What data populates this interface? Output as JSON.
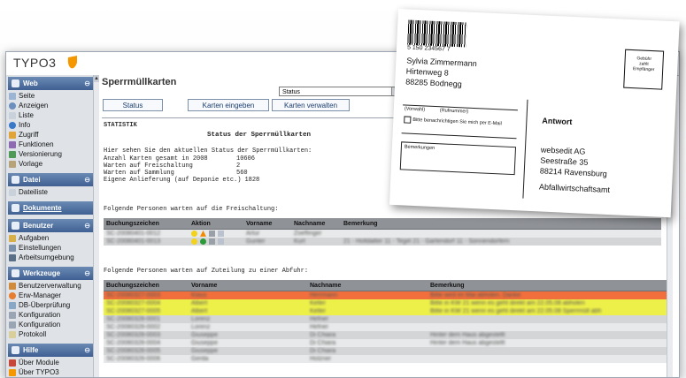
{
  "logo": {
    "text": "TYPO3"
  },
  "sidebar": {
    "groups": [
      {
        "label": "Web",
        "toggle": "⊖"
      },
      {
        "label": "Datei",
        "toggle": "⊖"
      },
      {
        "label": "Dokumente"
      },
      {
        "label": "Benutzer",
        "toggle": "⊖"
      },
      {
        "label": "Werkzeuge",
        "toggle": "⊖"
      },
      {
        "label": "Hilfe",
        "toggle": "⊖"
      }
    ],
    "web_items": [
      "Seite",
      "Anzeigen",
      "Liste",
      "Info",
      "Zugriff",
      "Funktionen",
      "Versionierung",
      "Vorlage"
    ],
    "datei_items": [
      "Dateiliste"
    ],
    "benutzer_items": [
      "Aufgaben",
      "Einstellungen",
      "Arbeitsumgebung"
    ],
    "werkzeuge_items": [
      "Benutzerverwaltung",
      "Erw-Manager",
      "DB-Überprüfung",
      "Konfiguration",
      "Konfiguration",
      "Protokoll"
    ],
    "hilfe_items": [
      "Über Module",
      "Über TYPO3"
    ]
  },
  "main": {
    "title": "Sperrmüllkarten",
    "select_value": "Status",
    "tabs": [
      "Status",
      "Karten eingeben",
      "Karten verwalten"
    ],
    "section_label": "STATISTIK",
    "status_title": "Status der Sperrmüllkarten",
    "intro": "Hier sehen Sie den aktuellen Status der Sperrmüllkarten:",
    "stats": [
      {
        "label": "Anzahl Karten gesamt in 2008",
        "value": "10606"
      },
      {
        "label": "Warten auf Freischaltung",
        "value": "2"
      },
      {
        "label": "Warten auf Sammlung",
        "value": "560"
      },
      {
        "label": "Eigene Anlieferung (auf Deponie etc.)",
        "value": "1828"
      }
    ],
    "table1_caption": "Folgende Personen warten auf die Freischaltung:",
    "table1_headers": [
      "Buchungszeichen",
      "Aktion",
      "Vorname",
      "Nachname",
      "Bemerkung"
    ],
    "table1_rows": [
      {
        "code": "SC-20080401-0012",
        "first": "Artur",
        "last": "Zoeffinger",
        "note": ""
      },
      {
        "code": "SC-20080401-0013",
        "first": "Gunter",
        "last": "Kurt",
        "note": "21 - Holtdatter 11 - Tegel 21 - Gartendorf 11 - Sonnendorfern"
      }
    ],
    "table2_caption": "Folgende Personen warten auf Zuteilung zu einer Abfuhr:",
    "table2_headers": [
      "Buchungszeichen",
      "Vorname",
      "Nachname",
      "Bemerkung"
    ],
    "table2_rows": [
      {
        "code": "SC-20080327-0003",
        "first": "Klaus",
        "last": "Herrmann",
        "note": "Bitte wird im Mai abholen. Danke",
        "color": "orange"
      },
      {
        "code": "SC-20080327-0004",
        "first": "Albert",
        "last": "Keller",
        "note": "Bitte in KW 21 wenn es geht direkt am 22.05.08 abholen",
        "color": "yellow"
      },
      {
        "code": "SC-20080327-0005",
        "first": "Albert",
        "last": "Keller",
        "note": "Bitte in KW 21 wenn es geht direkt am 22.05.08 Sperrmüll abh",
        "color": "yellow"
      },
      {
        "code": "SC-20080328-0001",
        "first": "Lorenz",
        "last": "Hefner",
        "note": "",
        "color": "gray"
      },
      {
        "code": "SC-20080328-0002",
        "first": "Lorenz",
        "last": "Hefner",
        "note": "",
        "color": "light"
      },
      {
        "code": "SC-20080328-0003",
        "first": "Giuseppe",
        "last": "Di Chiara",
        "note": "Hinter dem Haus abgestellt",
        "color": "gray"
      },
      {
        "code": "SC-20080328-0004",
        "first": "Giuseppe",
        "last": "Di Chiara",
        "note": "Hinter dem Haus abgestellt",
        "color": "light"
      },
      {
        "code": "SC-20080328-0005",
        "first": "Giuseppe",
        "last": "Di Chiara",
        "note": "",
        "color": "gray"
      },
      {
        "code": "SC-20080328-0006",
        "first": "Gerda",
        "last": "Holzner",
        "note": "",
        "color": "light"
      }
    ]
  },
  "postcard": {
    "barcode_number": "5 150 234567 7",
    "sender": [
      "Sylvia Zimmermann",
      "Hirtenweg 8",
      "88285 Bodnegg"
    ],
    "stamp_text": [
      "Gebühr",
      "zahlt",
      "Empfänger"
    ],
    "field_vorwahl": "(Vorwahl)",
    "field_rufnummer": "(Rufnummer)",
    "checkbox_label": "Bitte benachrichtigen Sie mich per E-Mail",
    "field_bemerkungen": "Bemerkungen",
    "antwort": "Antwort",
    "recipient": [
      "websedit AG",
      "Seestraße 35",
      "88214 Ravensburg",
      "Abfallwirtschaftsamt"
    ]
  }
}
